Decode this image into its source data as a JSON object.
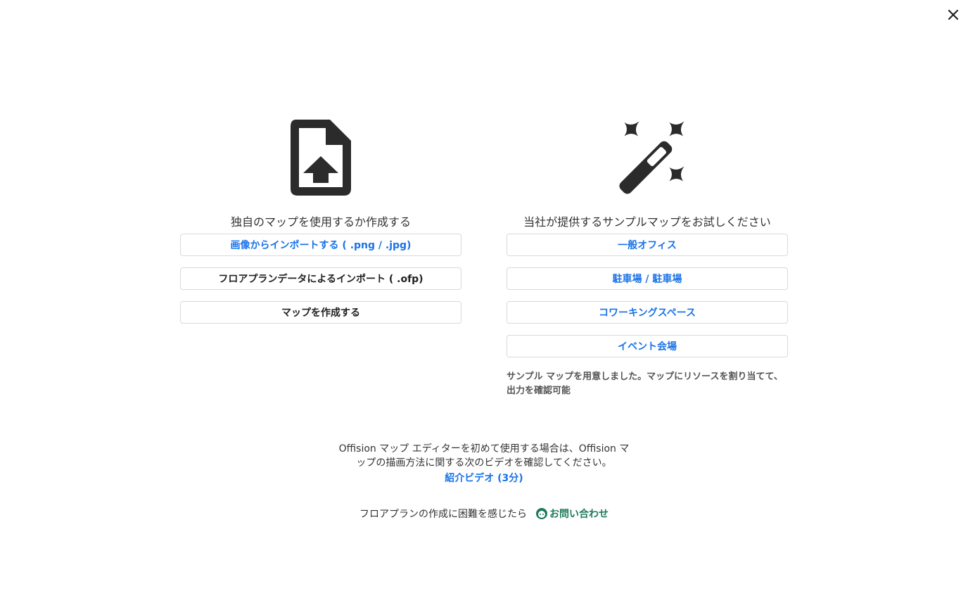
{
  "close_icon": "close-icon",
  "left": {
    "icon": "file-upload-icon",
    "title": "独自のマップを使用するか作成する",
    "buttons": [
      {
        "label": "画像からインポートする ( .png / .jpg)"
      },
      {
        "label": "フロアプランデータによるインポート ( .ofp)"
      },
      {
        "label": "マップを作成する"
      }
    ]
  },
  "right": {
    "icon": "magic-wand-icon",
    "title": "当社が提供するサンプルマップをお試しください",
    "buttons": [
      {
        "label": "一般オフィス"
      },
      {
        "label": "駐車場 / 駐車場"
      },
      {
        "label": "コワーキングスペース"
      },
      {
        "label": "イベント会場"
      }
    ],
    "note": "サンプル マップを用意しました。マップにリソースを割り当てて、出力を確認可能"
  },
  "intro": {
    "text": "Offision マップ エディターを初めて使用する場合は、Offision マップの描画方法に関する次のビデオを確認してください。",
    "video_link": "紹介ビデオ (3分)"
  },
  "help": {
    "text": "フロアプランの作成に困難を感じたら",
    "contact_link": "お問い合わせ",
    "contact_icon": "support-agent-icon"
  },
  "colors": {
    "link_blue": "#1a73e8",
    "contact_green": "#1e7a5a"
  }
}
